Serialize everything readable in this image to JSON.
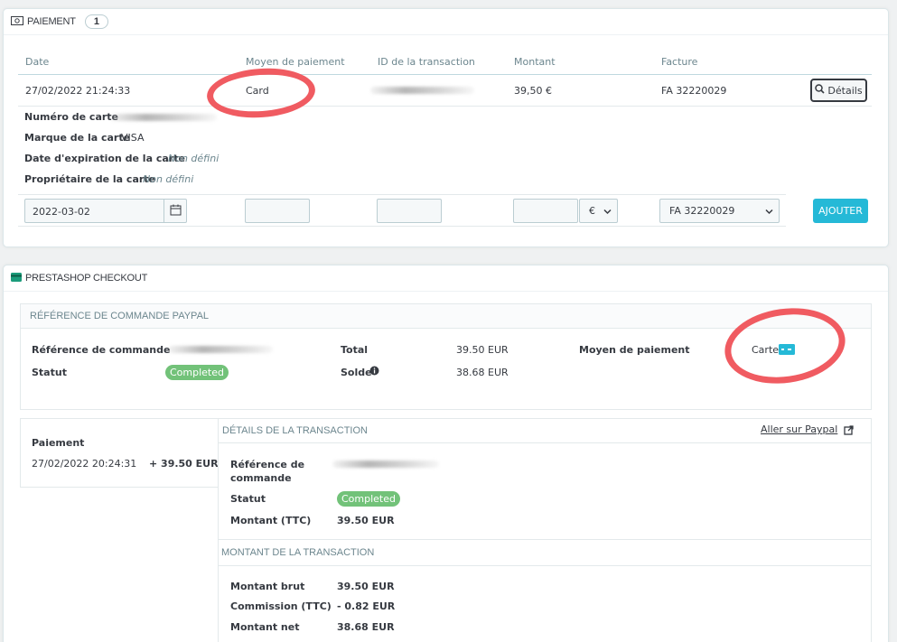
{
  "payment_panel": {
    "title": "Paiement",
    "count": "1",
    "columns": {
      "date": "Date",
      "method": "Moyen de paiement",
      "transaction_id": "ID de la transaction",
      "amount": "Montant",
      "invoice": "Facture"
    },
    "row": {
      "date": "27/02/2022 21:24:33",
      "method": "Card",
      "amount": "39,50 €",
      "invoice": "FA 32220029",
      "details_label": "Détails"
    },
    "card": {
      "number_label": "Numéro de carte",
      "brand_label": "Marque de la carte",
      "brand_value": "VISA",
      "expiry_label": "Date d'expiration de la carte",
      "expiry_value": "Non défini",
      "owner_label": "Propriétaire de la carte",
      "owner_value": "Non défini"
    },
    "form": {
      "date_value": "2022-03-02",
      "currency": "€",
      "invoice_select": "FA 32220029",
      "add_label": "Ajouter"
    }
  },
  "checkout_panel": {
    "title": "PrestaShop Checkout",
    "reference_section": {
      "title": "Référence de commande PayPal",
      "order_ref_label": "Référence de commande",
      "status_label": "Statut",
      "status_value": "Completed",
      "total_label": "Total",
      "total_value": "39.50 EUR",
      "balance_label": "Solde",
      "balance_value": "38.68 EUR",
      "method_label": "Moyen de paiement",
      "method_value": "Carte"
    },
    "payment_list": {
      "label": "Paiement",
      "date": "27/02/2022 20:24:31",
      "amount": "+ 39.50 EUR"
    },
    "transaction_details": {
      "title": "Détails de la transaction",
      "paypal_link": "Aller sur Paypal",
      "order_ref_label": "Référence de commande",
      "status_label": "Statut",
      "status_value": "Completed",
      "amount_ttc_label": "Montant (TTC)",
      "amount_ttc_value": "39.50 EUR"
    },
    "transaction_amount": {
      "title": "Montant de la transaction",
      "gross_label": "Montant brut",
      "gross_value": "39.50 EUR",
      "fee_label": "Commission (TTC)",
      "fee_value": "- 0.82 EUR",
      "net_label": "Montant net",
      "net_value": "38.68 EUR"
    }
  },
  "colors": {
    "accent": "#25b9d7",
    "success": "#72c279",
    "annotation": "#f05b61"
  }
}
